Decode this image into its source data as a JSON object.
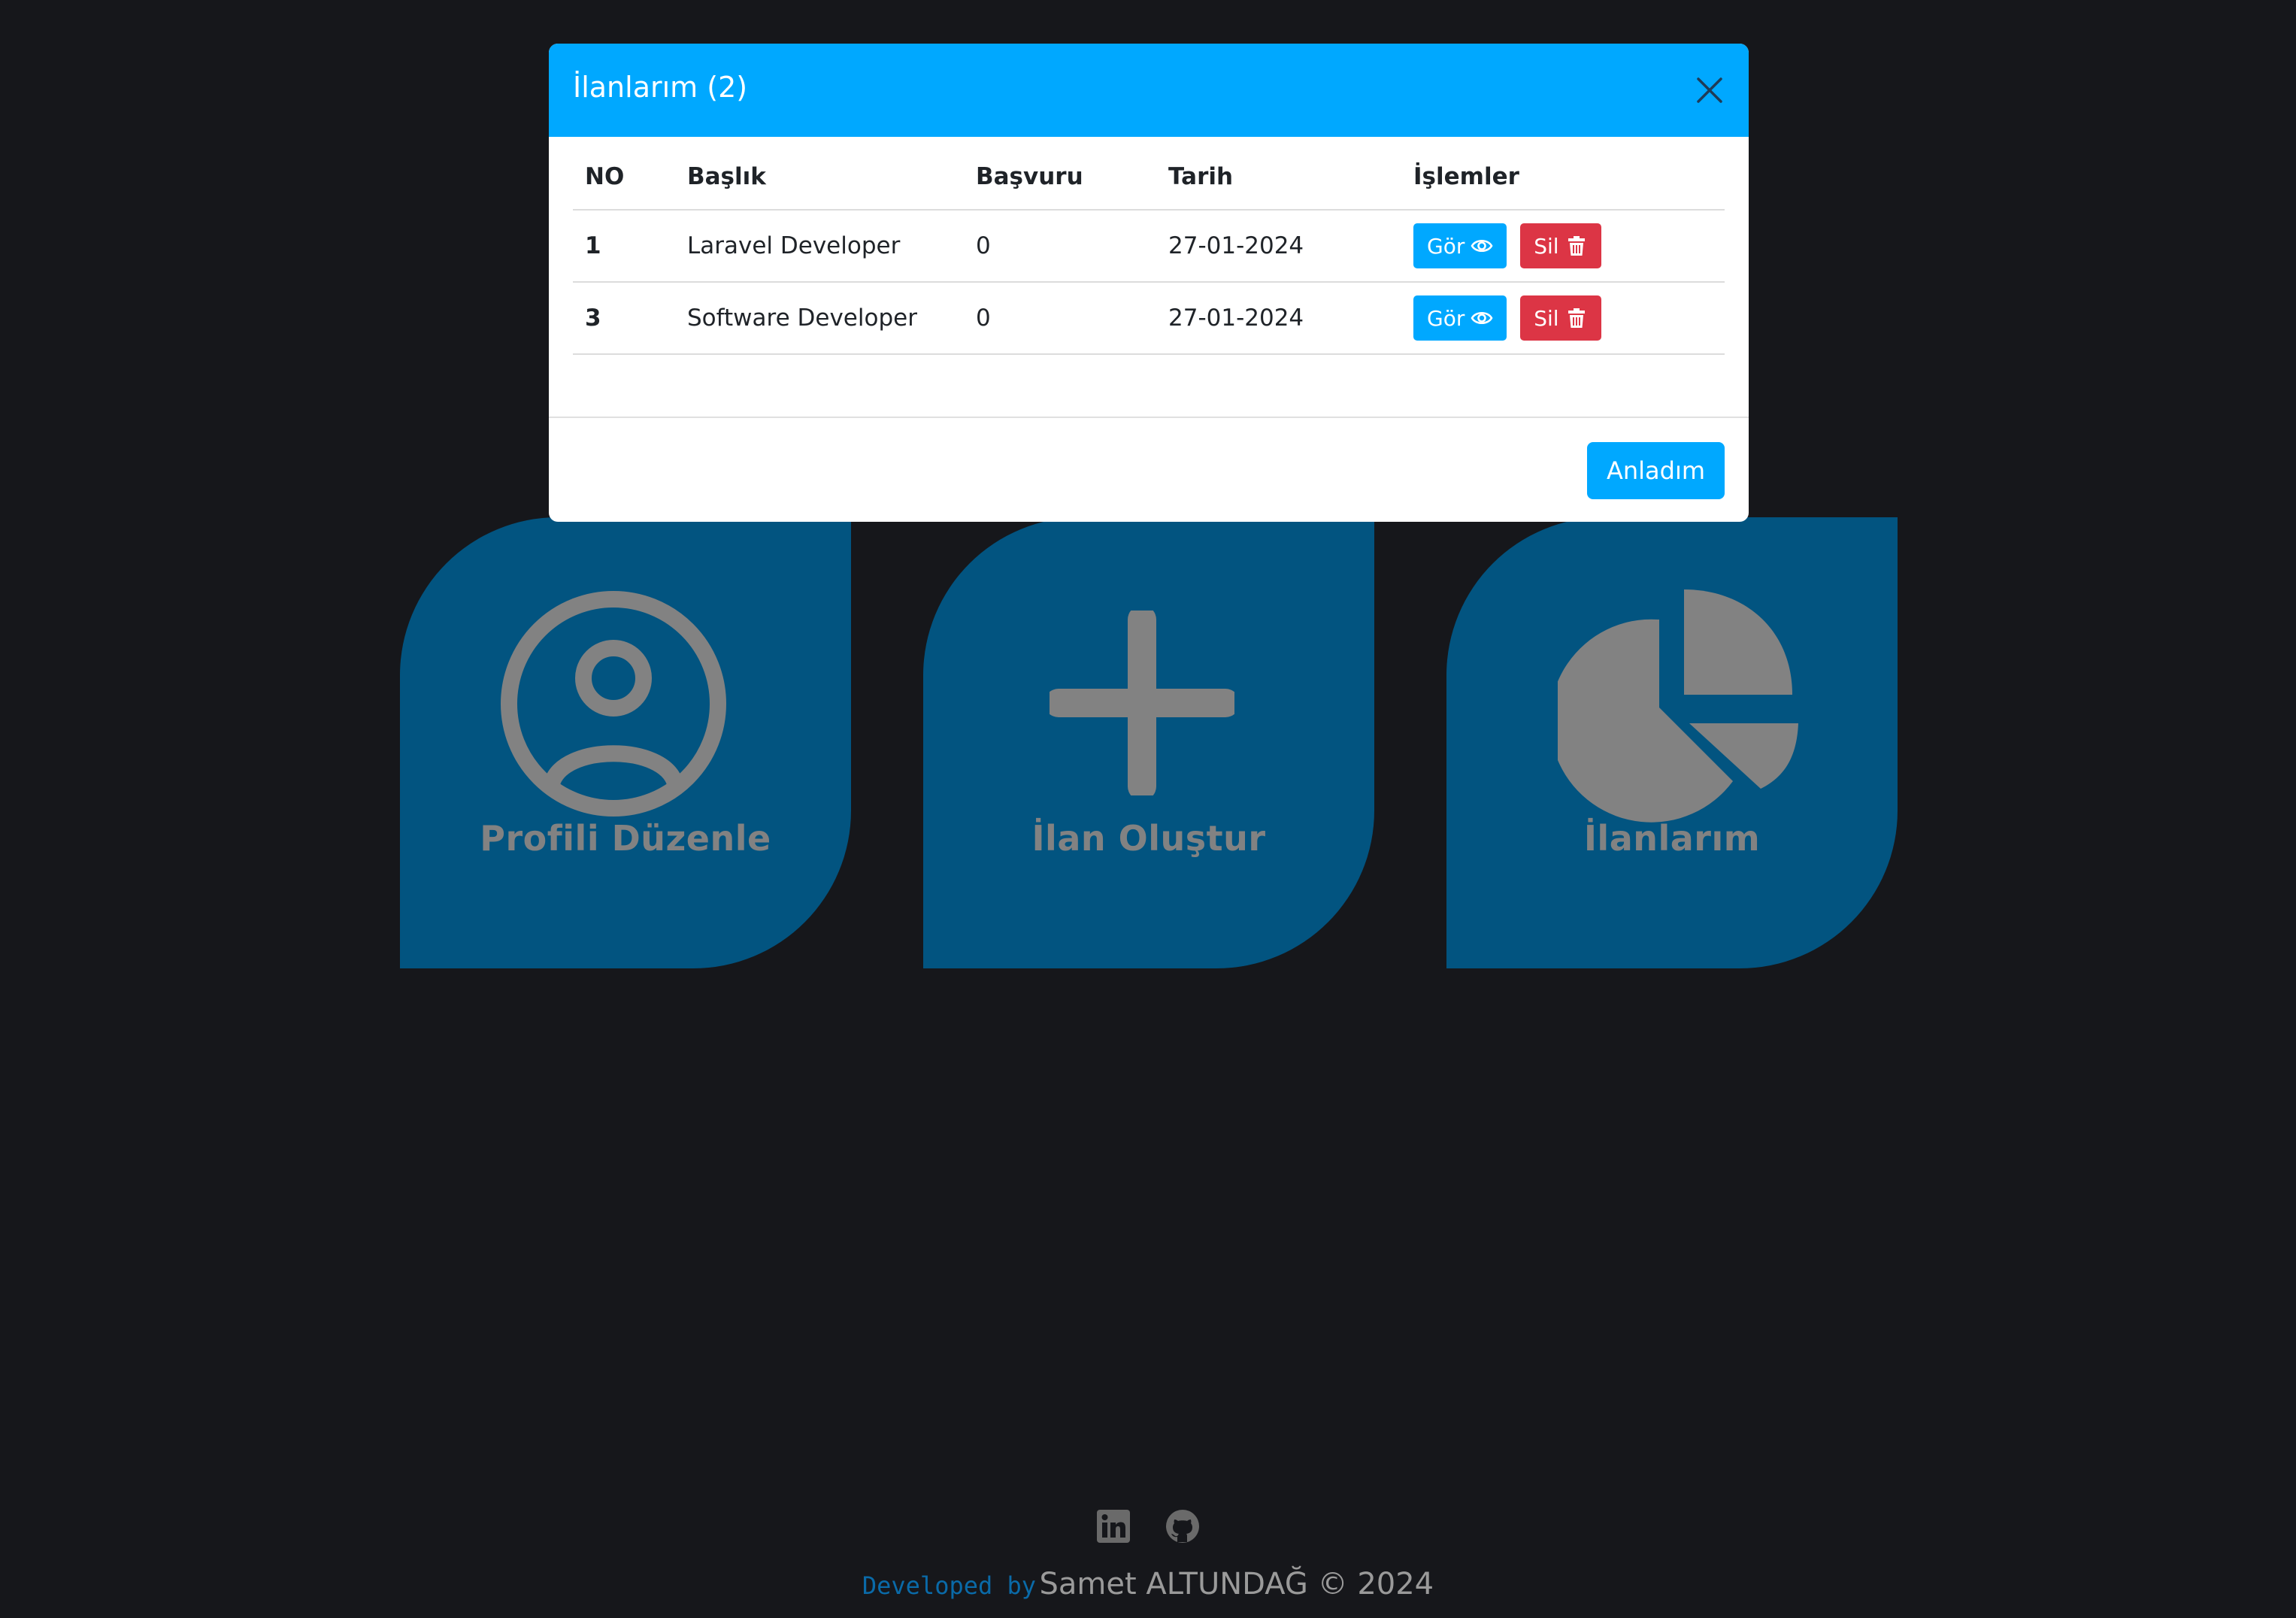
{
  "tiles": [
    {
      "label": "Profili Düzenle",
      "icon": "user-circle-icon"
    },
    {
      "label": "İlan Oluştur",
      "icon": "plus-icon"
    },
    {
      "label": "İlanlarım",
      "icon": "pie-chart-icon"
    }
  ],
  "modal": {
    "title": "İlanlarım (2)",
    "columns": [
      "NO",
      "Başlık",
      "Başvuru",
      "Tarih",
      "İşlemler"
    ],
    "rows": [
      {
        "no": "1",
        "title": "Laravel Developer",
        "applications": "0",
        "date": "27-01-2024"
      },
      {
        "no": "3",
        "title": "Software Developer",
        "applications": "0",
        "date": "27-01-2024"
      }
    ],
    "view_label": "Gör",
    "delete_label": "Sil",
    "ok_label": "Anladım"
  },
  "footer": {
    "developed_by": "Developed by",
    "author": "Samet ALTUNDAĞ © 2024",
    "icons": [
      "linkedin-icon",
      "github-icon"
    ]
  },
  "colors": {
    "background": "#16171b",
    "tile": "#025480",
    "tile_content": "#828282",
    "primary": "#00a8ff",
    "danger": "#dc3545"
  }
}
